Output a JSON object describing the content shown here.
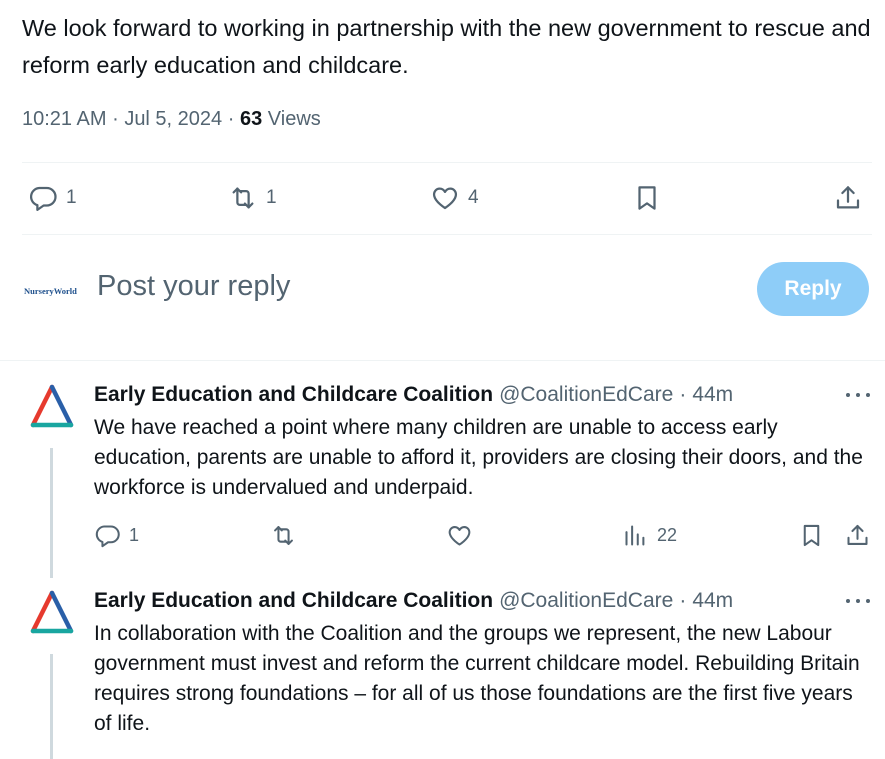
{
  "main_post": {
    "text": "We look forward to working in partnership with the new government to rescue and reform early education and childcare.",
    "time": "10:21 AM",
    "date": "Jul 5, 2024",
    "views_count": "63",
    "views_label": "Views",
    "replies": "1",
    "reposts": "1",
    "likes": "4"
  },
  "composer": {
    "avatar_text": "NurseryWorld",
    "placeholder": "Post your reply",
    "reply_label": "Reply"
  },
  "replies": [
    {
      "name": "Early Education and Childcare Coalition",
      "handle": "@CoalitionEdCare",
      "time": "44m",
      "text": "We have reached a point where many children are unable to access early education, parents are unable to afford it, providers are closing their doors, and the workforce is undervalued and underpaid.",
      "reply_count": "1",
      "view_count": "22"
    },
    {
      "name": "Early Education and Childcare Coalition",
      "handle": "@CoalitionEdCare",
      "time": "44m",
      "text": "In collaboration with the Coalition and the groups we represent, the new Labour government must invest and reform the current childcare model. Rebuilding Britain requires strong foundations – for all of us those foundations are the first five years of life."
    }
  ],
  "separator": "·",
  "colors": {
    "text": "#0f1419",
    "secondary": "#536471",
    "reply_button": "#8ecdf8",
    "divider": "#eff3f4",
    "logo_red": "#e63a2e",
    "logo_blue": "#2a5fa8",
    "logo_teal": "#19a6a0"
  }
}
